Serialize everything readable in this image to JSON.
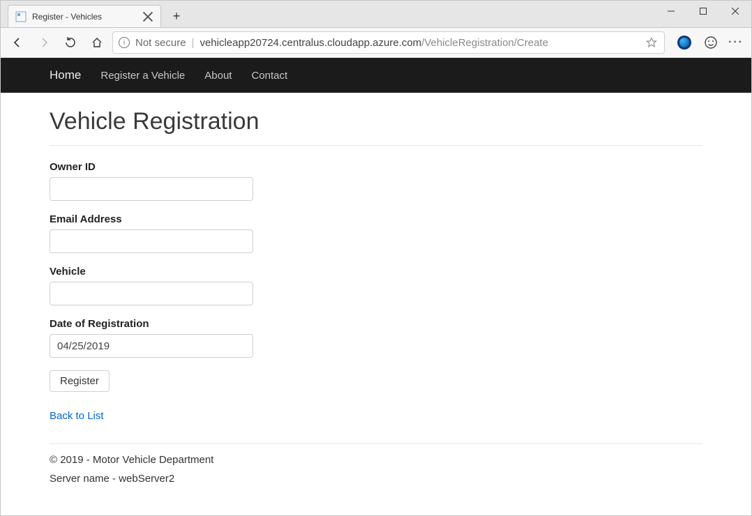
{
  "browser": {
    "tab_title": "Register - Vehicles",
    "security_label": "Not secure",
    "url_host": "vehicleapp20724.centralus.cloudapp.azure.com",
    "url_path": "/VehicleRegistration/Create"
  },
  "nav": {
    "items": [
      {
        "label": "Home",
        "active": true
      },
      {
        "label": "Register a Vehicle",
        "active": false
      },
      {
        "label": "About",
        "active": false
      },
      {
        "label": "Contact",
        "active": false
      }
    ]
  },
  "page": {
    "title": "Vehicle Registration",
    "fields": {
      "owner_id": {
        "label": "Owner ID",
        "value": ""
      },
      "email": {
        "label": "Email Address",
        "value": ""
      },
      "vehicle": {
        "label": "Vehicle",
        "value": ""
      },
      "date": {
        "label": "Date of Registration",
        "value": "04/25/2019"
      }
    },
    "submit_label": "Register",
    "back_link_label": "Back to List"
  },
  "footer": {
    "copyright": "© 2019 - Motor Vehicle Department",
    "server": "Server name - webServer2"
  }
}
